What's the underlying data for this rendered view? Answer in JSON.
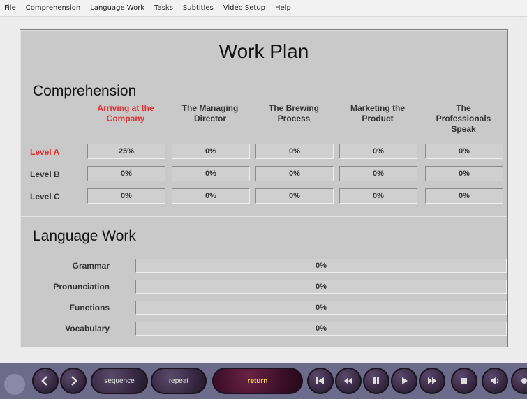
{
  "menu": [
    "File",
    "Comprehension",
    "Language Work",
    "Tasks",
    "Subtitles",
    "Video Setup",
    "Help"
  ],
  "title": "Work Plan",
  "comprehension": {
    "heading": "Comprehension",
    "columns": [
      {
        "l1": "",
        "l2": "Arriving at the",
        "l3": "Company",
        "active": true
      },
      {
        "l1": "",
        "l2": "The Managing",
        "l3": "Director",
        "active": false
      },
      {
        "l1": "",
        "l2": "The Brewing",
        "l3": "Process",
        "active": false
      },
      {
        "l1": "",
        "l2": "Marketing the",
        "l3": "Product",
        "active": false
      },
      {
        "l1": "The",
        "l2": "Professionals",
        "l3": "Speak",
        "active": false
      }
    ],
    "rows": [
      {
        "label": "Level A",
        "active": true,
        "values": [
          "25%",
          "0%",
          "0%",
          "0%",
          "0%"
        ]
      },
      {
        "label": "Level B",
        "active": false,
        "values": [
          "0%",
          "0%",
          "0%",
          "0%",
          "0%"
        ]
      },
      {
        "label": "Level C",
        "active": false,
        "values": [
          "0%",
          "0%",
          "0%",
          "0%",
          "0%"
        ]
      }
    ]
  },
  "language_work": {
    "heading": "Language Work",
    "items": [
      {
        "label": "Grammar",
        "value": "0%",
        "progress": 0
      },
      {
        "label": "Pronunciation",
        "value": "0%",
        "progress": 0
      },
      {
        "label": "Functions",
        "value": "0%",
        "progress": 0
      },
      {
        "label": "Vocabulary",
        "value": "0%",
        "progress": 0
      }
    ]
  },
  "controls": {
    "sequence": "sequence",
    "repeat": "repeat",
    "return": "return"
  },
  "colors": {
    "active": "#e03030",
    "return_text": "#ffe94a"
  }
}
